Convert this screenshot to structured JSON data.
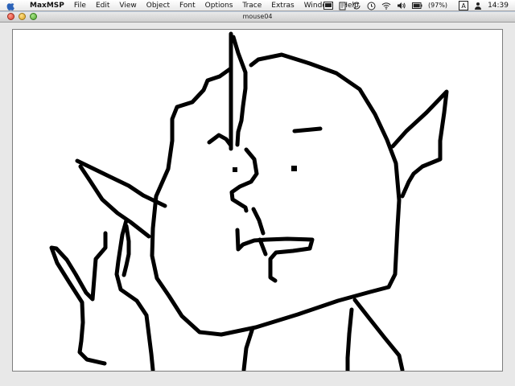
{
  "menubar": {
    "apple_icon": "apple-logo-icon",
    "app_name": "MaxMSP",
    "items": [
      "File",
      "Edit",
      "View",
      "Object",
      "Font",
      "Options",
      "Trace",
      "Extras",
      "Window",
      "Help"
    ],
    "status": {
      "battery_text": "(97%)",
      "input_badge": "A",
      "clock": "14:39"
    }
  },
  "window": {
    "title": "mouse04",
    "buttons": [
      "close",
      "minimize",
      "zoom"
    ]
  },
  "canvas": {
    "background": "#ffffff",
    "stroke": "#000000"
  }
}
